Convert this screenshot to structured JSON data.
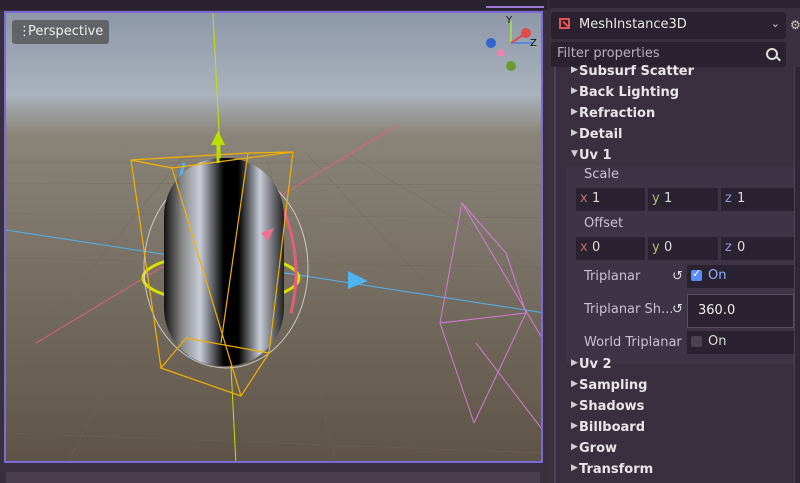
{
  "viewport": {
    "view_mode": "Perspective",
    "gizmo_axes": [
      "Y",
      "Z"
    ]
  },
  "inspector": {
    "node_type": "MeshInstance3D",
    "filter_placeholder": "Filter properties",
    "sections_top": [
      "Subsurf Scatter",
      "Back Lighting",
      "Refraction",
      "Detail"
    ],
    "uv1": {
      "label": "Uv 1",
      "scale_label": "Scale",
      "scale": {
        "x": "1",
        "y": "1",
        "z": "1"
      },
      "offset_label": "Offset",
      "offset": {
        "x": "0",
        "y": "0",
        "z": "0"
      },
      "triplanar_label": "Triplanar",
      "triplanar_value": "On",
      "triplanar_sharpness_label": "Triplanar Sh...",
      "triplanar_sharpness_value": "360.0",
      "world_triplanar_label": "World Triplanar",
      "world_triplanar_value": "On"
    },
    "sections_bottom": [
      "Uv 2",
      "Sampling",
      "Shadows",
      "Billboard",
      "Grow",
      "Transform"
    ]
  },
  "colors": {
    "accent": "#7b6ad8",
    "panel_bg": "#3b3040",
    "field_bg": "#2a2230"
  }
}
